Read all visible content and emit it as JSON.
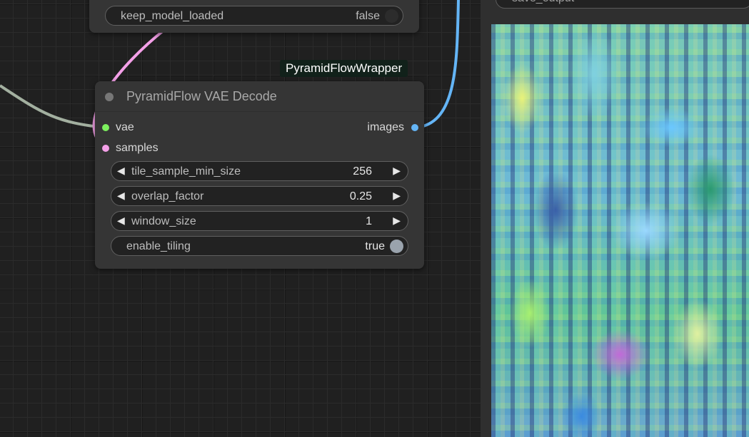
{
  "node_top": {
    "widget_label": "keep_model_loaded",
    "widget_value": "false"
  },
  "badge": {
    "text": "PyramidFlowWrapper"
  },
  "vae_decode": {
    "title": "PyramidFlow VAE Decode",
    "inputs": [
      {
        "label": "vae",
        "color": "#7df05e"
      },
      {
        "label": "samples",
        "color": "#f4a0e8"
      }
    ],
    "output": {
      "label": "images",
      "color": "#64b5f6"
    },
    "widgets": [
      {
        "label": "tile_sample_min_size",
        "value": "256"
      },
      {
        "label": "overlap_factor",
        "value": "0.25"
      },
      {
        "label": "window_size",
        "value": "1"
      }
    ],
    "toggle": {
      "label": "enable_tiling",
      "value": "true"
    }
  },
  "panel": {
    "save_input": "save_output"
  },
  "colors": {
    "link_vae": "#a3b0a0",
    "link_samples": "#f4a0e8",
    "link_images": "#64b5f6",
    "knob_off": "#2c2c2c",
    "knob_on": "#9aa3ad"
  }
}
